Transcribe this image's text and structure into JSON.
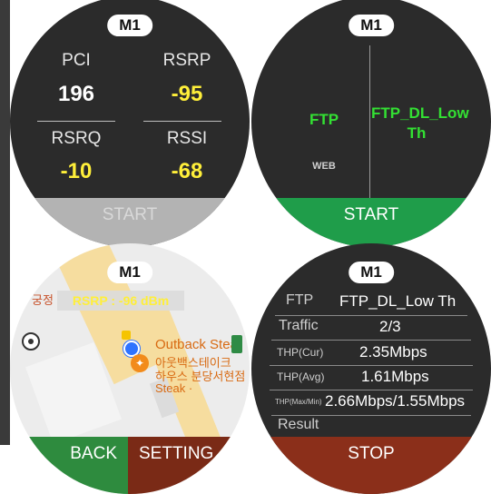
{
  "w1": {
    "tag": "M1",
    "pci_label": "PCI",
    "pci_value": "196",
    "rsrp_label": "RSRP",
    "rsrp_value": "-95",
    "rsrq_label": "RSRQ",
    "rsrq_value": "-10",
    "rssi_label": "RSSI",
    "rssi_value": "-68",
    "start_label": "START"
  },
  "w2": {
    "tag": "M1",
    "left_main": "FTP",
    "left_sub": "WEB",
    "right_main_line1": "FTP_DL_Low",
    "right_main_line2": "Th",
    "start_label": "START"
  },
  "w3": {
    "tag": "M1",
    "rsrp_overlay": "RSRP : -96 dBm",
    "poi_en": "Outback Stea",
    "poi_kr1": "아웃백스테이크",
    "poi_kr2": "하우스 분당서현점",
    "poi_en2": "Steak ·",
    "left_kr": "궁정",
    "back_label": "BACK",
    "setting_label": "SETTING"
  },
  "w4": {
    "tag": "M1",
    "rows": [
      {
        "k": "FTP",
        "v": "FTP_DL_Low Th"
      },
      {
        "k": "Traffic",
        "v": "2/3"
      },
      {
        "k": "THP(Cur)",
        "v": "2.35Mbps"
      },
      {
        "k": "THP(Avg)",
        "v": "1.61Mbps"
      },
      {
        "k": "THP(Max/Min)",
        "v": "2.66Mbps/1.55Mbps"
      },
      {
        "k": "Result",
        "v": ""
      }
    ],
    "stop_label": "STOP"
  },
  "colors": {
    "watch_bg": "#2b2b2b",
    "yellow": "#ffef3a",
    "green_text": "#33e033",
    "start_green": "#1f9d4a",
    "start_disabled": "#b3b3b3",
    "back_green": "#2e8b3e",
    "setting_brown": "#7a2a16",
    "stop_brown": "#8b2f1a"
  }
}
